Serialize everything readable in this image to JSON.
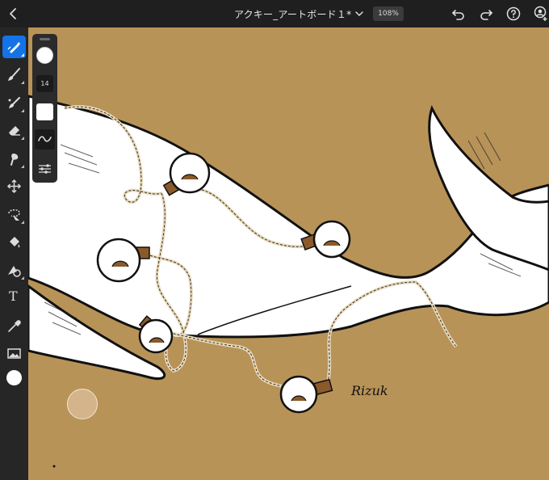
{
  "topbar": {
    "document_title": "アクキー_アートボード１*",
    "zoom": "108%"
  },
  "icons": {
    "back": "chevron-left-icon",
    "title_menu": "chevron-down-icon",
    "undo": "undo-icon",
    "redo": "redo-icon",
    "help": "help-icon",
    "share": "invite-user-icon"
  },
  "toolbar": {
    "tools": [
      "vector-brush",
      "pixel-brush",
      "mixer-brush",
      "eraser",
      "smudge",
      "move",
      "lasso-select",
      "fill",
      "shape",
      "text",
      "eyedropper",
      "image",
      "color"
    ],
    "text_tool_glyph": "T",
    "active_tool": "vector-brush",
    "active_color": "#ffffff"
  },
  "brush_panel": {
    "brush_size": "14",
    "fill_color": "#ffffff"
  },
  "canvas": {
    "background_color": "#b89358",
    "signature_text": "Rizuk",
    "puck_color": "#d4b48a"
  },
  "colors": {
    "accent": "#1473e6",
    "toolbar_bg": "#262626",
    "topbar_bg": "#1f1f1f"
  }
}
